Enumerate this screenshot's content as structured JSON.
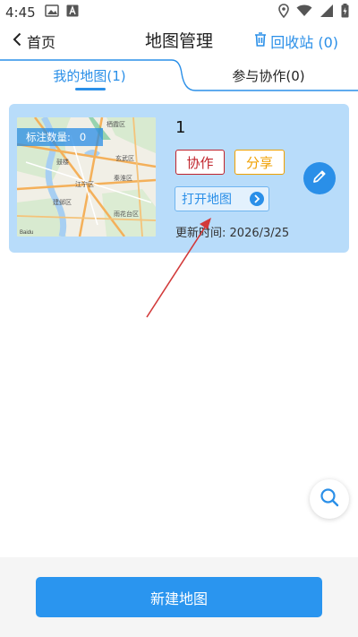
{
  "status_bar": {
    "time": "4:45"
  },
  "header": {
    "back_label": "首页",
    "title": "地图管理",
    "recycle_label": "回收站 (0)"
  },
  "tabs": [
    {
      "label": "我的地图(1)",
      "active": true
    },
    {
      "label": "参与协作(0)",
      "active": false
    }
  ],
  "maps": [
    {
      "name": "1",
      "marker_count_label": "标注数量:",
      "marker_count": "0",
      "collab_label": "协作",
      "share_label": "分享",
      "open_label": "打开地图",
      "update_label": "更新时间:",
      "update_time": "2026/3/25",
      "thumb_labels": [
        "栖霞区",
        "鼓楼",
        "建邺区",
        "江宁区",
        "玄武区",
        "秦淮区",
        "雨花台区",
        "Baidu"
      ]
    }
  ],
  "bottom": {
    "new_map_label": "新建地图"
  },
  "colors": {
    "accent": "#2a8fe8",
    "card_bg": "#b8dcfa",
    "collab_red": "#c0232b",
    "share_orange": "#f0a000"
  },
  "icons": {
    "back": "chevron-left-icon",
    "recycle": "trash-icon",
    "edit": "pencil-icon",
    "open": "chevron-right-icon",
    "search": "search-icon"
  }
}
